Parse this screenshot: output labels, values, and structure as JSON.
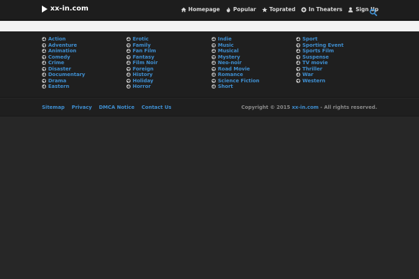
{
  "header": {
    "logo_text": "xx-in.com",
    "nav": [
      {
        "label": "Homepage",
        "icon": "home-icon"
      },
      {
        "label": "Popular",
        "icon": "fire-icon"
      },
      {
        "label": "Toprated",
        "icon": "star-icon"
      },
      {
        "label": "In Theaters",
        "icon": "circle-plus-icon"
      },
      {
        "label": "Sign Up",
        "icon": "user-icon"
      }
    ],
    "search_icon": "search-icon"
  },
  "genres": {
    "columns": [
      [
        "Action",
        "Adventure",
        "Animation",
        "Comedy",
        "Crime",
        "Disaster",
        "Documentary",
        "Drama",
        "Eastern"
      ],
      [
        "Erotic",
        "Family",
        "Fan Film",
        "Fantasy",
        "Film Noir",
        "Foreign",
        "History",
        "Holiday",
        "Horror"
      ],
      [
        "Indie",
        "Music",
        "Musical",
        "Mystery",
        "Neo-noir",
        "Road Movie",
        "Romance",
        "Science Fiction",
        "Short"
      ],
      [
        "Sport",
        "Sporting Event",
        "Sports Film",
        "Suspense",
        "TV movie",
        "Thriller",
        "War",
        "Western"
      ]
    ]
  },
  "footer": {
    "links": [
      "Sitemap",
      "Privacy",
      "DMCA Notice",
      "Contact Us"
    ],
    "copyright_prefix": "Copyright © 2015 ",
    "copyright_site": "xx-in.com",
    "copyright_suffix": " - All rights reserved."
  },
  "colors": {
    "accent": "#3f8fd1",
    "background": "#272727",
    "header": "#1d1d1d"
  }
}
